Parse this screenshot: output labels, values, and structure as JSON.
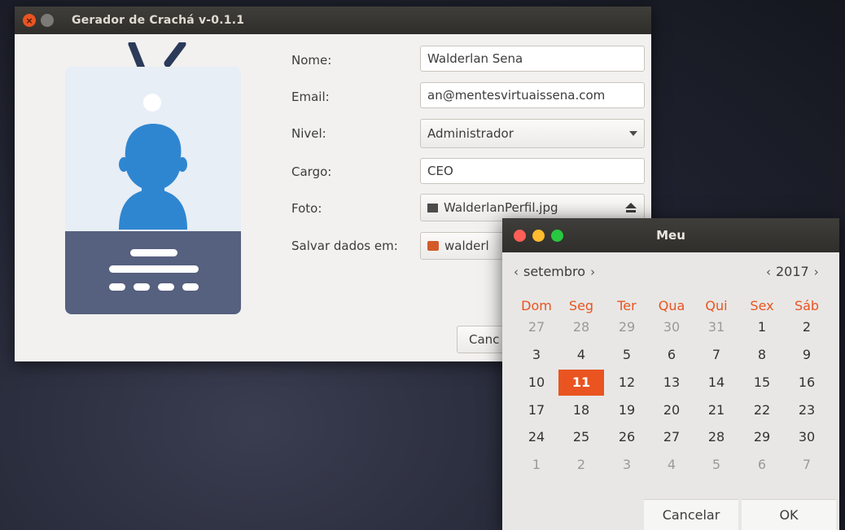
{
  "window": {
    "title": "Gerador de Crachá v-0.1.1"
  },
  "form": {
    "nome_label": "Nome:",
    "nome_value": "Walderlan Sena",
    "email_label": "Email:",
    "email_value": "an@mentesvirtuaissena.com",
    "nivel_label": "Nivel:",
    "nivel_value": "Administrador",
    "cargo_label": "Cargo:",
    "cargo_value": "CEO",
    "foto_label": "Foto:",
    "foto_value": "WalderlanPerfil.jpg",
    "salvar_label": "Salvar dados em:",
    "salvar_value": "walderl",
    "cancel_label": "Canc"
  },
  "calendar": {
    "title": "Meu",
    "month": "setembro",
    "year": "2017",
    "weekdays": [
      "Dom",
      "Seg",
      "Ter",
      "Qua",
      "Qui",
      "Sex",
      "Sáb"
    ],
    "weeks": [
      [
        {
          "d": "27",
          "o": true
        },
        {
          "d": "28",
          "o": true
        },
        {
          "d": "29",
          "o": true
        },
        {
          "d": "30",
          "o": true
        },
        {
          "d": "31",
          "o": true
        },
        {
          "d": "1"
        },
        {
          "d": "2"
        }
      ],
      [
        {
          "d": "3"
        },
        {
          "d": "4"
        },
        {
          "d": "5"
        },
        {
          "d": "6"
        },
        {
          "d": "7"
        },
        {
          "d": "8"
        },
        {
          "d": "9"
        }
      ],
      [
        {
          "d": "10"
        },
        {
          "d": "11",
          "sel": true
        },
        {
          "d": "12"
        },
        {
          "d": "13"
        },
        {
          "d": "14"
        },
        {
          "d": "15"
        },
        {
          "d": "16"
        }
      ],
      [
        {
          "d": "17"
        },
        {
          "d": "18"
        },
        {
          "d": "19"
        },
        {
          "d": "20"
        },
        {
          "d": "21"
        },
        {
          "d": "22"
        },
        {
          "d": "23"
        }
      ],
      [
        {
          "d": "24"
        },
        {
          "d": "25"
        },
        {
          "d": "26"
        },
        {
          "d": "27"
        },
        {
          "d": "28"
        },
        {
          "d": "29"
        },
        {
          "d": "30"
        }
      ],
      [
        {
          "d": "1",
          "o": true
        },
        {
          "d": "2",
          "o": true
        },
        {
          "d": "3",
          "o": true
        },
        {
          "d": "4",
          "o": true
        },
        {
          "d": "5",
          "o": true
        },
        {
          "d": "6",
          "o": true
        },
        {
          "d": "7",
          "o": true
        }
      ]
    ],
    "cancel_label": "Cancelar",
    "ok_label": "OK"
  },
  "colors": {
    "accent": "#e95420",
    "titlebar": "#3a3935",
    "badge_blue": "#2f86d0",
    "badge_dark": "#56607f",
    "dot_red": "#ff5f57",
    "dot_yellow": "#febc2e",
    "dot_green": "#28c840"
  }
}
